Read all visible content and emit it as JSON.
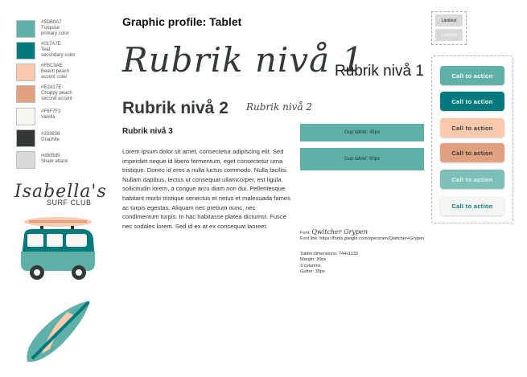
{
  "title": "Graphic profile: Tablet",
  "colors": [
    {
      "hex": "#5DB0A7",
      "name": "Turquise",
      "role": "primary color",
      "color": "#5fb0a7"
    },
    {
      "hex": "#017A7E",
      "name": "Teal",
      "role": "secondary color",
      "color": "#017a7e"
    },
    {
      "hex": "#FBC9AE",
      "name": "Beach peach",
      "role": "accent color",
      "color": "#fbc9ae"
    },
    {
      "hex": "#E2A17E",
      "name": "Choppy peach",
      "role": "second accent",
      "color": "#e2a17e"
    },
    {
      "hex": "#F6F7F3",
      "name": "Vanilla",
      "role": "",
      "color": "#f6f7f3"
    },
    {
      "hex": "#333838",
      "name": "Graphite",
      "role": "",
      "color": "#333838"
    },
    {
      "hex": "#d9d9d9",
      "name": "Shark attack",
      "role": "",
      "color": "#d9d9d9"
    }
  ],
  "logo": {
    "script": "Isabella's",
    "sub": "SURF CLUB"
  },
  "typography": {
    "h1_script": "Rubrik nivå 1",
    "h1": "Rubrik nivå 1",
    "h2": "Rubrik nivå 2",
    "h2_script": "Rubrik nivå 2",
    "h3": "Rubrik nivå 3",
    "body": "Lorem ipsum dolor sit amet, consectetur adipiscing elit. Sed imperdiet neque id libero fermentum, eget consectetur urna tristique. Donec id eros a nulla luctus commodo. Nulla facilisi. Nullam dapibus, lectus ut consequat ullamcorper, est ligula sollicitudin lorem, a congue arcu diam non dui. Pellentesque habitant morbi tristique senectus et netus et malesuada fames ac turpis egestas. Aliquam nec pretium nunc, nec condimentum turpis. In hac habitasse platea dictumst. Fusce nec sodales lorem. Sed id ex at ex consequat laoreet."
  },
  "gaps": {
    "gap1": "Gap tablet: 45px",
    "gap2": "Gap tablet: 60px"
  },
  "font_info": {
    "font_label": "Font:",
    "font_name": "Qwitcher Grypen",
    "font_link": "Font link: https://fonts.google.com/specimen/Qwitcher+Grypen"
  },
  "dimensions": {
    "line1": "Tablet dimensions: 744x1133",
    "line2": "Margin: 30px",
    "line3": "3 columns",
    "line4": "Gutter: 30px"
  },
  "links": {
    "link1": "Länktext",
    "link2": "Länktext"
  },
  "cta_label": "Call to action"
}
